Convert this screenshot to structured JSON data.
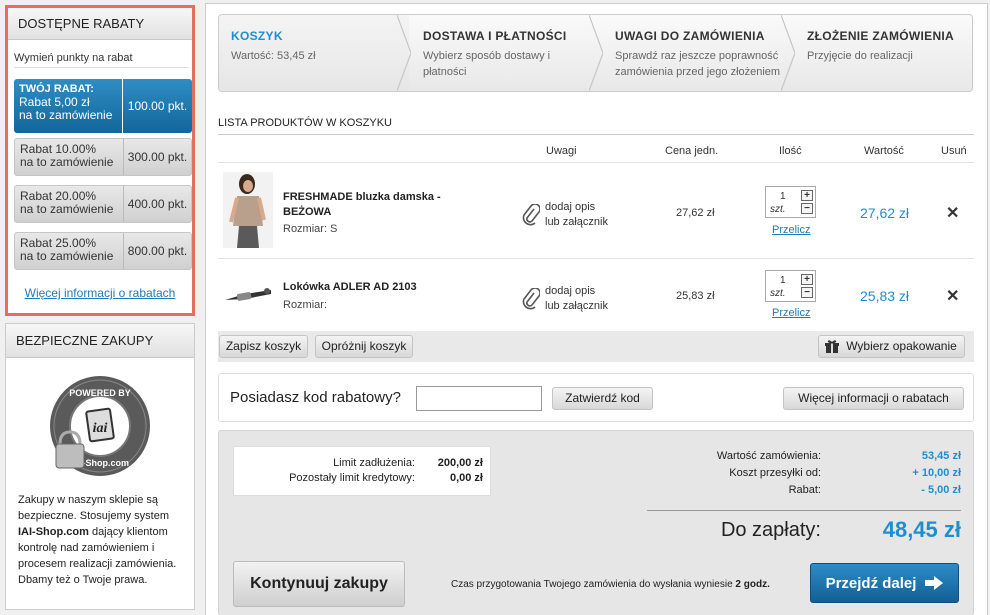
{
  "sidebar": {
    "discounts": {
      "title": "DOSTĘPNE RABATY",
      "exchange_label": "Wymień punkty na rabat",
      "items": [
        {
          "label_top": "TWÓJ RABAT:",
          "label": "Rabat 5,00 zł",
          "label2": "na to zamówienie",
          "points": "100.00 pkt.",
          "active": true
        },
        {
          "label": "Rabat 10.00%",
          "label2": "na to zamówienie",
          "points": "300.00 pkt."
        },
        {
          "label": "Rabat 20.00%",
          "label2": "na to zamówienie",
          "points": "400.00 pkt."
        },
        {
          "label": "Rabat 25.00%",
          "label2": "na to zamówienie",
          "points": "800.00 pkt."
        }
      ],
      "more_link": "Więcej informacji o rabatach"
    },
    "safe": {
      "title": "BEZPIECZNE ZAKUPY",
      "seal_text": "POWERED BY IAI-Shop.com",
      "text_1": "Zakupy w naszym sklepie są bezpieczne. Stosujemy system ",
      "text_bold": "IAI-Shop.com",
      "text_2": " dający klientom kontrolę nad zamówieniem i procesem realizacji zamówienia. Dbamy też o Twoje prawa."
    }
  },
  "steps": [
    {
      "title": "KOSZYK",
      "desc": "Wartość: 53,45 zł"
    },
    {
      "title": "DOSTAWA I PŁATNOŚCI",
      "desc": "Wybierz sposób dostawy i płatności"
    },
    {
      "title": "UWAGI DO ZAMÓWIENIA",
      "desc": "Sprawdź raz jeszcze poprawność zamówienia przed jego złożeniem"
    },
    {
      "title": "ZŁOŻENIE ZAMÓWIENIA",
      "desc": "Przyjęcie do realizacji"
    }
  ],
  "cart": {
    "list_title": "LISTA PRODUKTÓW W KOSZYKU",
    "headers": {
      "notes": "Uwagi",
      "unit_price": "Cena jedn.",
      "qty": "Ilość",
      "value": "Wartość",
      "remove": "Usuń"
    },
    "items": [
      {
        "name_1": "FRESHMADE bluzka damska -",
        "name_2": "BEŻOWA",
        "size": "Rozmiar: S",
        "note_1": "dodaj opis",
        "note_2": "lub załącznik",
        "unit_price": "27,62 zł",
        "qty": "1",
        "unit": "szt.",
        "recalc": "Przelicz",
        "value": "27,62 zł",
        "remove": "✕"
      },
      {
        "name_1": "Lokówka ADLER AD 2103",
        "name_2": "",
        "size": "Rozmiar:",
        "note_1": "dodaj opis",
        "note_2": "lub załącznik",
        "unit_price": "25,83 zł",
        "qty": "1",
        "unit": "szt.",
        "recalc": "Przelicz",
        "value": "25,83 zł",
        "remove": "✕"
      }
    ],
    "save_cart": "Zapisz koszyk",
    "empty_cart": "Opróżnij koszyk",
    "packaging": "Wybierz opakowanie"
  },
  "code": {
    "question": "Posiadasz kod rabatowy?",
    "input_value": "",
    "confirm": "Zatwierdź kod",
    "more": "Więcej informacji o rabatach"
  },
  "summary": {
    "credit_limit_label": "Limit zadłużenia:",
    "credit_limit_value": "200,00 zł",
    "credit_left_label": "Pozostały limit kredytowy:",
    "credit_left_value": "0,00 zł",
    "order_value_label": "Wartość zamówienia:",
    "order_value": "53,45 zł",
    "shipping_label": "Koszt przesyłki od:",
    "shipping_value": "+ 10,00 zł",
    "discount_label": "Rabat:",
    "discount_value": "- 5,00 zł",
    "to_pay_label": "Do zapłaty:",
    "to_pay_value": "48,45 zł",
    "continue_label": "Kontynuuj zakupy",
    "prep_text": "Czas przygotowania Twojego zamówienia do wysłania wyniesie",
    "prep_bold": "2 godz.",
    "next_label": "Przejdź dalej"
  },
  "colors": {
    "accent": "#1f8ecf",
    "highlight_border": "#e36f5f",
    "active_rebate": "#1b73a8"
  }
}
